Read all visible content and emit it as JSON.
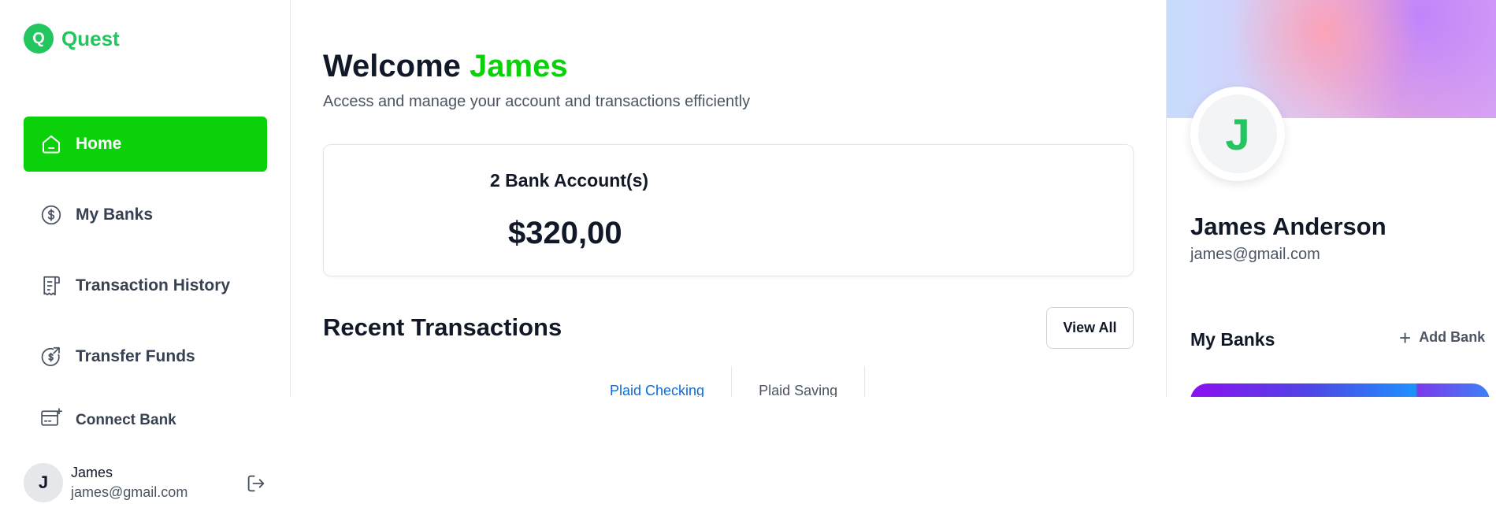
{
  "brand": {
    "logo_letter": "Q",
    "name": "Quest",
    "color": "#22c55e"
  },
  "sidebar": {
    "items": [
      {
        "label": "Home",
        "icon": "home-icon",
        "active": true
      },
      {
        "label": "My Banks",
        "icon": "dollar-circle-icon",
        "active": false
      },
      {
        "label": "Transaction History",
        "icon": "receipt-icon",
        "active": false
      },
      {
        "label": "Transfer Funds",
        "icon": "transfer-icon",
        "active": false
      }
    ],
    "connect_bank": {
      "label": "Connect Bank",
      "icon": "card-plus-icon"
    },
    "user": {
      "initial": "J",
      "name": "James",
      "email": "james@gmail.com"
    },
    "active_color": "#0ad10a"
  },
  "main": {
    "welcome_prefix": "Welcome",
    "welcome_name": "James",
    "subtitle": "Access and manage your account and transactions efficiently",
    "balance": {
      "accounts_label": "2 Bank Account(s)",
      "amount": "$320,00"
    },
    "recent_title": "Recent Transactions",
    "view_all": "View All",
    "tabs": [
      {
        "label": "Plaid Checking",
        "active": true
      },
      {
        "label": "Plaid Saving",
        "active": false
      }
    ]
  },
  "profile": {
    "initial": "J",
    "name": "James Anderson",
    "email": "james@gmail.com",
    "my_banks_title": "My Banks",
    "add_bank": "Add Bank"
  }
}
